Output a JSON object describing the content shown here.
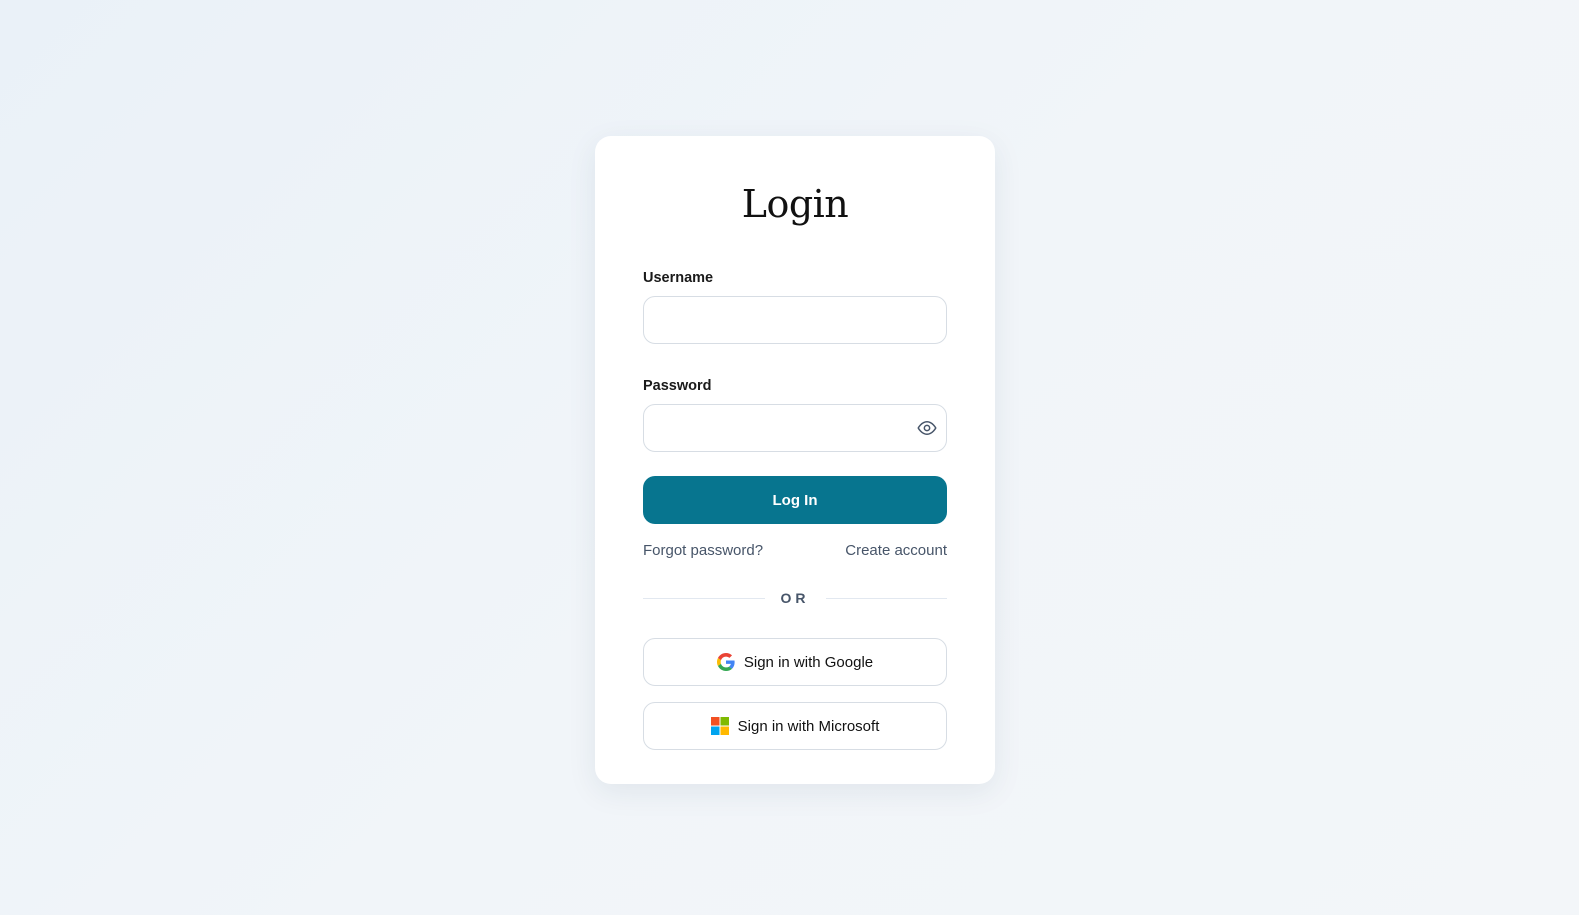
{
  "form": {
    "title": "Login",
    "username_label": "Username",
    "username_value": "",
    "password_label": "Password",
    "password_value": "",
    "login_label": "Log In",
    "forgot_label": "Forgot password?",
    "create_label": "Create account",
    "divider_label": "OR",
    "google_label": "Sign in with Google",
    "microsoft_label": "Sign in with Microsoft"
  },
  "icons": {
    "password_toggle": "eye-icon",
    "google": "google-icon",
    "microsoft": "microsoft-icon"
  },
  "colors": {
    "accent": "#07758f",
    "link": "#475569",
    "border": "#d7dde4"
  }
}
